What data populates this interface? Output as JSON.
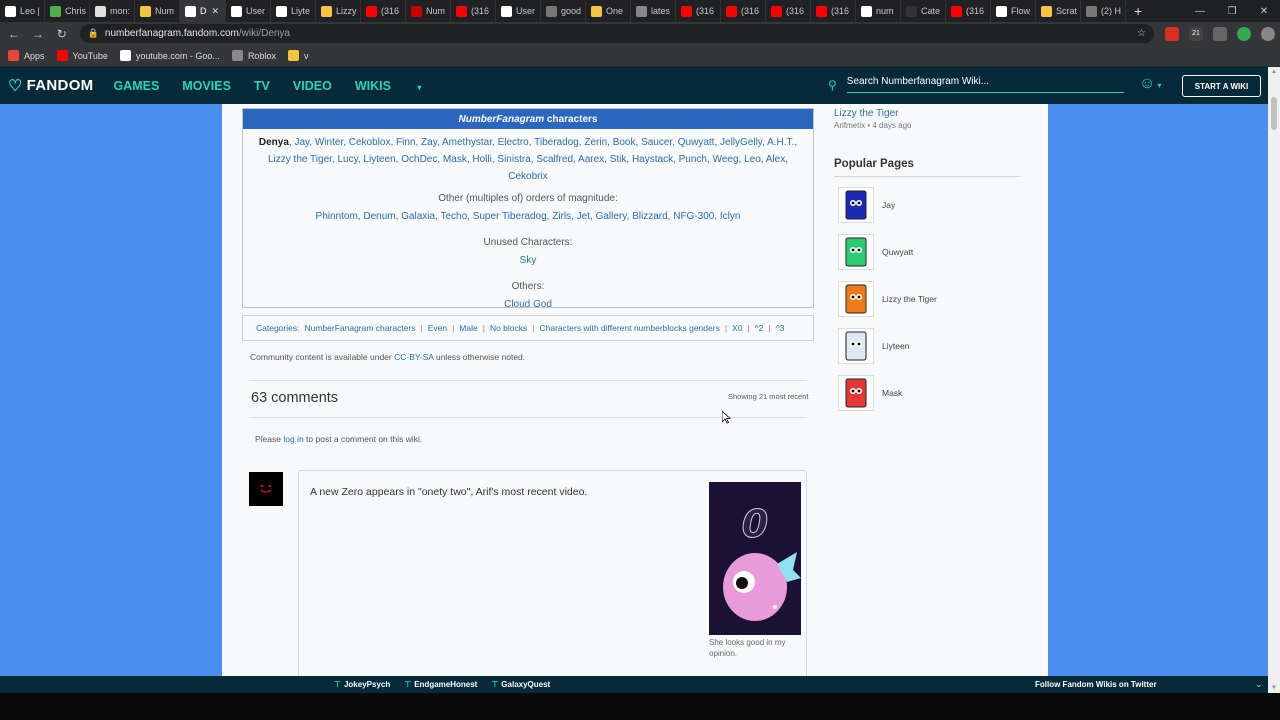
{
  "browser": {
    "tabs": [
      {
        "label": "Leo |",
        "color": "#ffffff"
      },
      {
        "label": "Chris",
        "color": "#4caf50"
      },
      {
        "label": "mon:",
        "color": "#e0e0e0"
      },
      {
        "label": "Num",
        "color": "#f5c542"
      },
      {
        "label": "D",
        "color": "#ffffff",
        "active": true
      },
      {
        "label": "User",
        "color": "#ffffff"
      },
      {
        "label": "Liyte",
        "color": "#ffffff"
      },
      {
        "label": "Lizzy",
        "color": "#f5c542"
      },
      {
        "label": "(316",
        "color": "#ff0000"
      },
      {
        "label": "Num",
        "color": "#cc0000"
      },
      {
        "label": "(316",
        "color": "#ff0000"
      },
      {
        "label": "User",
        "color": "#ffffff"
      },
      {
        "label": "good",
        "color": "#777777"
      },
      {
        "label": "One",
        "color": "#f5c542"
      },
      {
        "label": "lates",
        "color": "#888888"
      },
      {
        "label": "(316",
        "color": "#ff0000"
      },
      {
        "label": "(316",
        "color": "#ff0000"
      },
      {
        "label": "(316",
        "color": "#ff0000"
      },
      {
        "label": "(316",
        "color": "#ff0000"
      },
      {
        "label": "num",
        "color": "#ffffff"
      },
      {
        "label": "Cate",
        "color": "#333333"
      },
      {
        "label": "(316",
        "color": "#ff0000"
      },
      {
        "label": "Flow",
        "color": "#ffffff"
      },
      {
        "label": "Scrat",
        "color": "#f5c542"
      },
      {
        "label": "(2) H",
        "color": "#777777"
      }
    ],
    "new_tab": "+",
    "close_glyph": "✕",
    "window": {
      "min": "—",
      "max": "❐",
      "close": "✕"
    },
    "url_host": "numberfanagram.fandom.com",
    "url_path": "/wiki/Denya",
    "nav": {
      "back": "←",
      "forward": "→",
      "reload": "↻"
    },
    "bookmarks": [
      {
        "label": "Apps",
        "color": "#e8453c"
      },
      {
        "label": "YouTube",
        "color": "#ff0000"
      },
      {
        "label": "youtube.com - Goo...",
        "color": "#ffffff"
      },
      {
        "label": "Roblox",
        "color": "#888888"
      },
      {
        "label": "v",
        "color": "#f5c542"
      }
    ],
    "badge": "21"
  },
  "fandom": {
    "logo": "FANDOM",
    "nav": [
      "GAMES",
      "MOVIES",
      "TV",
      "VIDEO",
      "WIKIS"
    ],
    "search_placeholder": "Search Numberfanagram Wiki...",
    "start_wiki": "START A WIKI",
    "follow": "Follow Fandom Wikis on Twitter",
    "bottom_items": [
      "JokeyPsych",
      "EndgameHonest",
      "GalaxyQuest"
    ]
  },
  "navbox": {
    "title_italic": "NumberFanagram",
    "title_rest": " characters",
    "current": "Denya",
    "characters": [
      "Jay",
      "Winter",
      "Cekoblox",
      "Finn",
      "Zay",
      "Amethystar",
      "Electro",
      "Tiberadog",
      "Zerin",
      "Book",
      "Saucer",
      "Quwyatt",
      "JellyGelly",
      "A.H.T.",
      "Lizzy the Tiger",
      "Lucy",
      "Liyteen",
      "OchDec",
      "Mask",
      "Holli",
      "Sinistra",
      "Scalfred",
      "Aarex",
      "Stik",
      "Haystack",
      "Punch",
      "Weeg",
      "Leo",
      "Alex",
      "Cekobrix"
    ],
    "other_label": "Other (multiples of) orders of magnitude:",
    "other": [
      "Phinntom",
      "Denum",
      "Galaxia",
      "Techo",
      "Super Tiberadog",
      "Zirls",
      "Jet",
      "Gallery",
      "Blizzard",
      "NFG-300",
      "Iclyn"
    ],
    "unused_label": "Unused Characters:",
    "unused": "Sky",
    "others_label": "Others:",
    "others": "Cloud God"
  },
  "categories": {
    "label": "Categories:",
    "items": [
      "NumberFanagram characters",
      "Even",
      "Male",
      "No blocks",
      "Characters with different numberblocks genders",
      "X0",
      "^2",
      "^3"
    ]
  },
  "license": {
    "prefix": "Community content is available under ",
    "link": "CC-BY-SA",
    "suffix": " unless otherwise noted."
  },
  "comments": {
    "count": "63 comments",
    "showing": "Showing 21 most recent",
    "please_prefix": "Please ",
    "please_link": "log in",
    "please_suffix": " to post a comment on this wiki.",
    "first": {
      "text": "A new Zero appears in \"onety two\", Arif's most recent video.",
      "caption": "She looks good in my opinion.",
      "image_glyph": "0"
    }
  },
  "rail": {
    "recent_title": "Lizzy the Tiger",
    "recent_meta": "Arifmetix • 4 days ago",
    "popular_title": "Popular Pages",
    "popular": [
      {
        "label": "Jay",
        "color": "#1c2bb5"
      },
      {
        "label": "Quwyatt",
        "color": "#2ecc71"
      },
      {
        "label": "Lizzy the Tiger",
        "color": "#f07a1a"
      },
      {
        "label": "Liyteen",
        "color": "#dfe8f5"
      },
      {
        "label": "Mask",
        "color": "#e53935"
      }
    ]
  },
  "colors": {
    "accent": "#26d5b4",
    "navy": "#072a3a",
    "link": "#2e6ea6",
    "navbox_head": "#2b66bf",
    "page_bg": "#4a8ef0"
  }
}
